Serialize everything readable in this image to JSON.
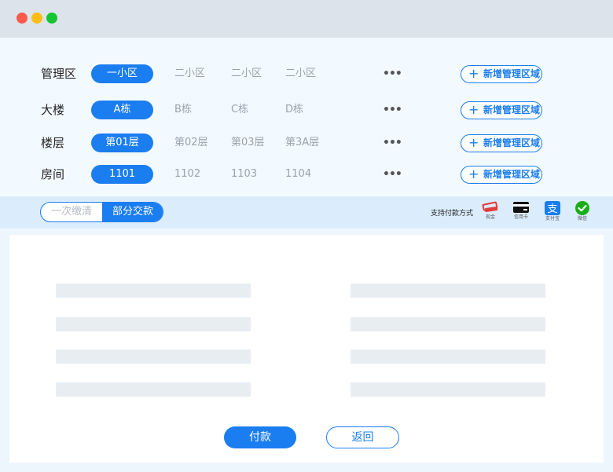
{
  "selector": {
    "more_label": "•••",
    "add_label": "新增管理区域",
    "rows": [
      {
        "label": "管理区",
        "selected": "一小区",
        "options": [
          "二小区",
          "二小区",
          "二小区"
        ]
      },
      {
        "label": "大楼",
        "selected": "A栋",
        "options": [
          "B栋",
          "C栋",
          "D栋"
        ]
      },
      {
        "label": "楼层",
        "selected": "第01层",
        "options": [
          "第02层",
          "第03层",
          "第3A层"
        ]
      },
      {
        "label": "房间",
        "selected": "1101",
        "options": [
          "1102",
          "1103",
          "1104"
        ]
      }
    ]
  },
  "payment": {
    "mode_options": [
      "一次缴清",
      "部分交款"
    ],
    "selected_mode": "部分交款",
    "methods_label": "支持付款方式",
    "methods": [
      {
        "name": "现金",
        "icon": "cash-icon",
        "color": "#e33b3b"
      },
      {
        "name": "信用卡",
        "icon": "credit-card-icon",
        "color": "#111111"
      },
      {
        "name": "支付宝",
        "icon": "alipay-icon",
        "color": "#1a7df0"
      },
      {
        "name": "微信",
        "icon": "wechat-icon",
        "color": "#1aad19"
      }
    ]
  },
  "actions": {
    "pay": "付款",
    "back": "返回"
  },
  "colors": {
    "accent": "#1a7df0",
    "titlebar": "#dde3ea",
    "placeholder": "#e8edf2"
  }
}
